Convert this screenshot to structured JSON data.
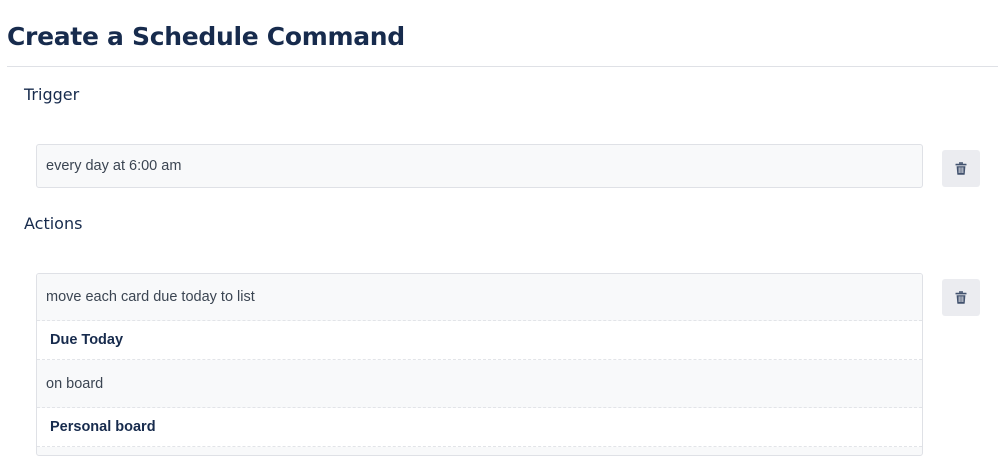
{
  "page": {
    "title": "Create a Schedule Command"
  },
  "trigger": {
    "heading": "Trigger",
    "text": "every day at 6:00 am",
    "delete_icon": "trash-icon"
  },
  "actions": {
    "heading": "Actions",
    "rows": [
      {
        "kind": "text",
        "value": "move each card due today to list"
      },
      {
        "kind": "value",
        "value": "Due Today"
      },
      {
        "kind": "text",
        "value": "on board"
      },
      {
        "kind": "value",
        "value": "Personal board"
      }
    ],
    "delete_icon": "trash-icon"
  },
  "colors": {
    "heading_text": "#172b4d",
    "box_background": "#f8f9fa",
    "box_border": "#dfe1e6",
    "button_background": "#ebecf0",
    "icon_color": "#42526e"
  }
}
